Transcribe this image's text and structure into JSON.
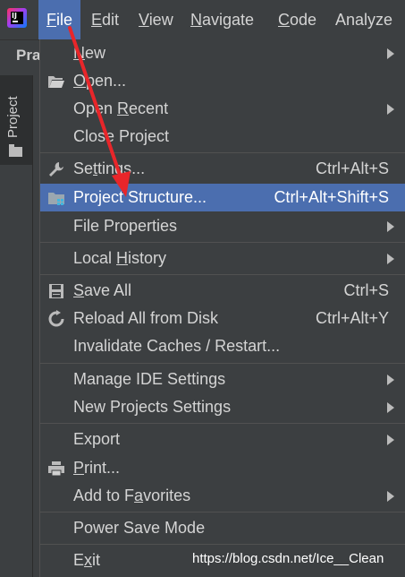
{
  "menubar": {
    "items": [
      {
        "pre": "",
        "mn": "F",
        "post": "ile"
      },
      {
        "pre": "",
        "mn": "E",
        "post": "dit"
      },
      {
        "pre": "",
        "mn": "V",
        "post": "iew"
      },
      {
        "pre": "",
        "mn": "N",
        "post": "avigate"
      },
      {
        "pre": "",
        "mn": "C",
        "post": "ode"
      },
      {
        "pre": "",
        "mn": "",
        "post": "Analyze"
      }
    ]
  },
  "subbar": {
    "text": "Pra"
  },
  "sidebar": {
    "tab_label": "Project"
  },
  "file_menu": {
    "new": {
      "pre": "",
      "mn": "N",
      "post": "ew"
    },
    "open": {
      "pre": "",
      "mn": "O",
      "post": "pen..."
    },
    "open_recent": {
      "pre": "Open ",
      "mn": "R",
      "post": "ecent"
    },
    "close_project": {
      "label": "Close Project"
    },
    "settings": {
      "pre": "Se",
      "mn": "t",
      "post": "tings...",
      "shortcut": "Ctrl+Alt+S"
    },
    "project_structure": {
      "label": "Project Structure...",
      "shortcut": "Ctrl+Alt+Shift+S"
    },
    "file_properties": {
      "label": "File Properties"
    },
    "local_history": {
      "pre": "Local ",
      "mn": "H",
      "post": "istory"
    },
    "save_all": {
      "pre": "",
      "mn": "S",
      "post": "ave All",
      "shortcut": "Ctrl+S"
    },
    "reload": {
      "label": "Reload All from Disk",
      "shortcut": "Ctrl+Alt+Y"
    },
    "invalidate": {
      "label": "Invalidate Caches / Restart..."
    },
    "manage_ide": {
      "label": "Manage IDE Settings"
    },
    "new_projects_settings": {
      "label": "New Projects Settings"
    },
    "export": {
      "label": "Export"
    },
    "print": {
      "pre": "",
      "mn": "P",
      "post": "rint..."
    },
    "favorites": {
      "pre": "Add to F",
      "mn": "a",
      "post": "vorites"
    },
    "power_save": {
      "label": "Power Save Mode"
    },
    "exit": {
      "pre": "E",
      "mn": "x",
      "post": "it"
    }
  },
  "watermark": "https://blog.csdn.net/Ice__Clean",
  "colors": {
    "highlight": "#4b6eaf",
    "annotation_arrow": "#e8262a",
    "menu_bg": "#3c3f41"
  }
}
